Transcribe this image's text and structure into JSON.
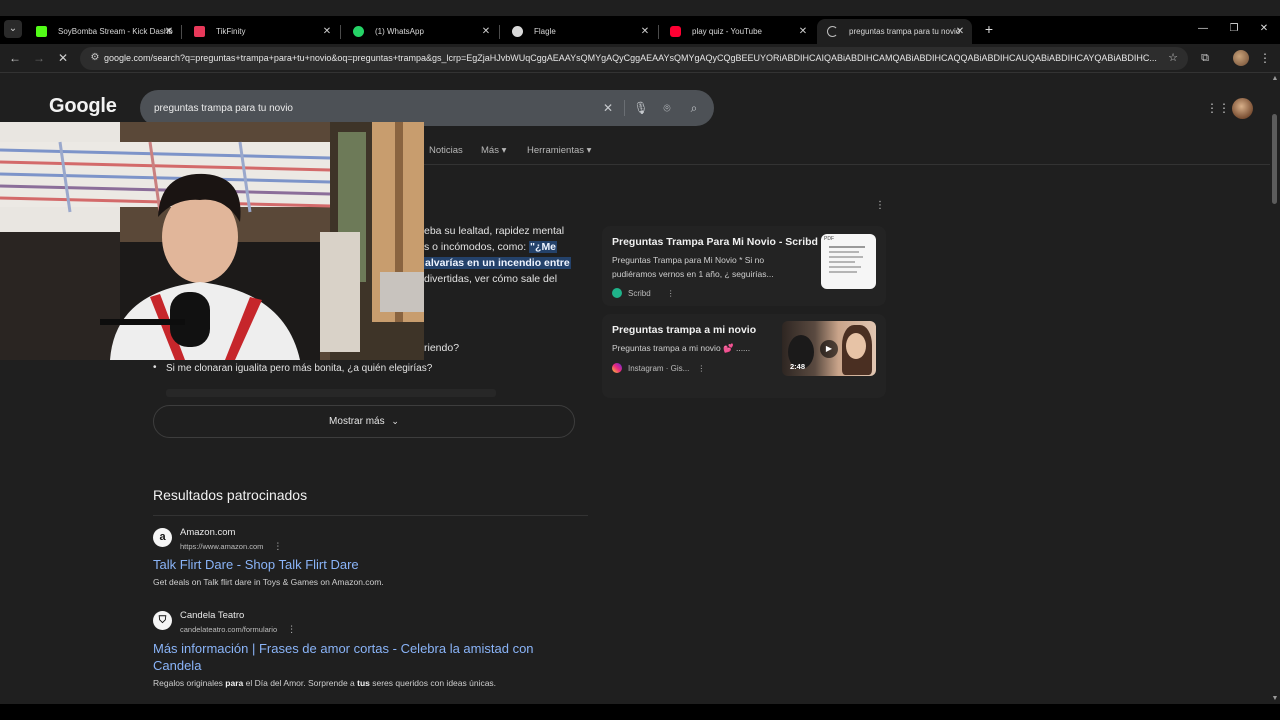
{
  "browser": {
    "tabs": [
      {
        "title": "SoyBomba Stream - Kick Dashb",
        "favicon_color": "#53fc18"
      },
      {
        "title": "TikFinity",
        "favicon_color": "#e8395a"
      },
      {
        "title": "(1) WhatsApp",
        "favicon_color": "#25d366"
      },
      {
        "title": "Flagle",
        "favicon_color": "#d9d9d9"
      },
      {
        "title": "play quiz - YouTube",
        "favicon_color": "#ff0033"
      },
      {
        "title": "preguntas trampa para tu novio",
        "favicon_color": "#bdbdbd"
      }
    ],
    "active_tab": 5,
    "url": "google.com/search?q=preguntas+trampa+para+tu+novio&oq=preguntas+trampa&gs_lcrp=EgZjaHJvbWUqCggAEAAYsQMYgAQyCggAEAAYsQMYgAQyCQgBEEUYORiABDIHCAIQABiABDIHCAMQABiABDIHCAQQABiABDIHCAUQABiABDIHCAYQABiABDIHC..."
  },
  "search": {
    "logo": "Google",
    "query": "preguntas trampa para tu novio",
    "filters": [
      "Noticias",
      "Más ▾",
      "Herramientas ▾"
    ]
  },
  "ai_snippet": {
    "line1": "eba su lealtad, rapidez mental",
    "line2_prefix": "s o incómodos, como: ",
    "line2_highlight": "\"¿Me",
    "line3_highlight": "alvarías en un incendio entre",
    "line4": "divertidas, ver cómo sale del",
    "line5": "riendo?"
  },
  "cards": [
    {
      "title": "Preguntas Trampa Para Mi Novio - Scribd",
      "desc1": "Preguntas Trampa para Mi Novio * Si no",
      "desc2": "pudiéramos vernos en 1 año, ¿ seguirías...",
      "source": "Scribd",
      "thumb_label": "PDF"
    },
    {
      "title": "Preguntas trampa a mi novio",
      "desc1": "Preguntas trampa a mi novio 💕 ......",
      "source": "Instagram · Gis...",
      "duration": "2:48"
    }
  ],
  "bullets": [
    "Si me clonaran igualita pero más bonita, ¿a quién elegirías?"
  ],
  "show_more": "Mostrar más",
  "sponsored": {
    "heading": "Resultados patrocinados",
    "ads": [
      {
        "site": "Amazon.com",
        "url": "https://www.amazon.com",
        "title": "Talk Flirt Dare - Shop Talk Flirt Dare",
        "desc": "Get deals on Talk flirt dare in Toys & Games on Amazon.com."
      },
      {
        "site": "Candela Teatro",
        "url": "candelateatro.com/formulario",
        "title_line1": "Más información | Frases de amor cortas - Celebra la amistad con",
        "title_line2": "Candela",
        "desc_parts": [
          "Regalos originales ",
          "para",
          " el Día del Amor. Sorprende a ",
          "tus",
          " seres queridos con ideas únicas."
        ]
      }
    ]
  },
  "colors": {
    "link": "#8ab4f8",
    "background": "#1f1f1f",
    "highlight": "#24426b"
  }
}
